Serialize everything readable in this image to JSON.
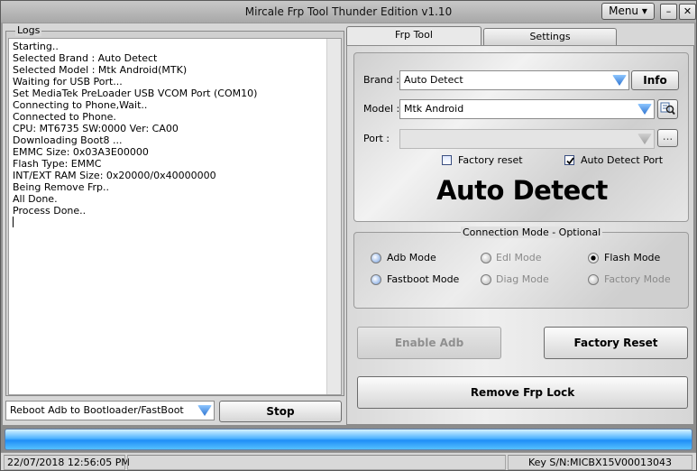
{
  "window": {
    "title": "Mircale Frp Tool Thunder Edition v1.10",
    "menu_label": "Menu ▾",
    "minimize": "–",
    "close": "✕"
  },
  "logs": {
    "legend": "Logs",
    "lines": [
      "Starting..",
      "Selected Brand : Auto Detect",
      "Selected Model : Mtk Android(MTK)",
      "Waiting for USB Port...",
      "Set MediaTek PreLoader USB VCOM Port (COM10)",
      "Connecting to Phone,Wait..",
      "Connected to Phone.",
      "CPU: MT6735 SW:0000 Ver: CA00",
      "Downloading Boot8 ...",
      "EMMC Size: 0x03A3E00000",
      "Flash Type: EMMC",
      "INT/EXT RAM  Size: 0x20000/0x40000000",
      "Being Remove Frp..",
      "All Done.",
      "Process Done.."
    ]
  },
  "bottom_left": {
    "action_select": "Reboot Adb to Bootloader/FastBoot",
    "stop_label": "Stop"
  },
  "tabs": [
    {
      "label": "Frp Tool",
      "active": true
    },
    {
      "label": "Settings",
      "active": false
    }
  ],
  "device": {
    "brand_label": "Brand :",
    "brand_value": "Auto Detect",
    "info_label": "Info",
    "model_label": "Model :",
    "model_value": "Mtk Android",
    "port_label": "Port :",
    "port_value": "",
    "port_more": "...",
    "factory_reset_label": "Factory reset",
    "factory_reset_checked": false,
    "auto_detect_port_label": "Auto Detect Port",
    "auto_detect_port_checked": true,
    "banner": "Auto Detect"
  },
  "connection": {
    "legend": "Connection Mode - Optional",
    "modes": [
      {
        "label": "Adb Mode",
        "enabled": true,
        "selected": false
      },
      {
        "label": "Edl Mode",
        "enabled": false,
        "selected": false
      },
      {
        "label": "Flash Mode",
        "enabled": true,
        "selected": true
      },
      {
        "label": "Fastboot Mode",
        "enabled": true,
        "selected": false
      },
      {
        "label": "Diag Mode",
        "enabled": false,
        "selected": false
      },
      {
        "label": "Factory Mode",
        "enabled": false,
        "selected": false
      }
    ]
  },
  "actions": {
    "enable_adb": "Enable Adb",
    "enable_adb_enabled": false,
    "factory_reset": "Factory Reset",
    "remove_frp": "Remove Frp Lock"
  },
  "progress": {
    "percent": 100,
    "color": "#2f9cf8"
  },
  "statusbar": {
    "datetime": "22/07/2018 12:56:05 PM",
    "key_sn": "Key S/N:MICBX15V00013043"
  },
  "icons": {
    "dropdown": "blue-down-arrow-icon",
    "model_search": "magnifier-list-icon"
  }
}
